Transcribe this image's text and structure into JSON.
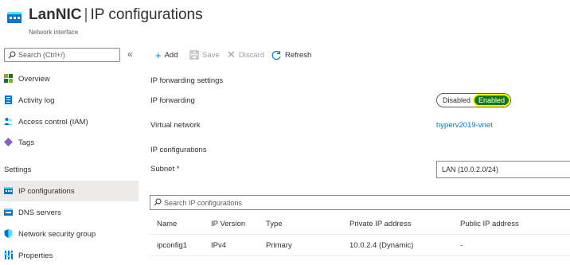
{
  "header": {
    "resource_name": "LanNIC",
    "separator": "|",
    "page_name": "IP configurations",
    "more": "···",
    "subtitle": "Network interface"
  },
  "sidebar": {
    "search_placeholder": "Search (Ctrl+/)",
    "collapse_glyph": "«",
    "items": [
      {
        "label": "Overview",
        "icon": "overview-icon"
      },
      {
        "label": "Activity log",
        "icon": "activity-log-icon"
      },
      {
        "label": "Access control (IAM)",
        "icon": "people-icon"
      },
      {
        "label": "Tags",
        "icon": "tag-icon"
      }
    ],
    "settings_header": "Settings",
    "settings_items": [
      {
        "label": "IP configurations",
        "icon": "nic-icon",
        "selected": true
      },
      {
        "label": "DNS servers",
        "icon": "dns-icon"
      },
      {
        "label": "Network security group",
        "icon": "shield-icon"
      },
      {
        "label": "Properties",
        "icon": "properties-icon"
      }
    ]
  },
  "toolbar": {
    "add": "Add",
    "save": "Save",
    "discard": "Discard",
    "refresh": "Refresh"
  },
  "main": {
    "ip_forwarding_settings": "IP forwarding settings",
    "ip_forwarding_label": "IP forwarding",
    "toggle": {
      "off": "Disabled",
      "on": "Enabled",
      "selected": "Enabled"
    },
    "virtual_network_label": "Virtual network",
    "virtual_network_value": "hyperv2019-vnet",
    "ip_configurations_heading": "IP configurations",
    "subnet_label": "Subnet *",
    "subnet_value": "LAN (10.0.2.0/24)",
    "search_placeholder": "Search IP configurations",
    "table": {
      "columns": [
        "Name",
        "IP Version",
        "Type",
        "Private IP address",
        "Public IP address"
      ],
      "rows": [
        [
          "ipconfig1",
          "IPv4",
          "Primary",
          "10.0.2.4 (Dynamic)",
          "-"
        ]
      ]
    }
  },
  "colors": {
    "accent": "#0078d4",
    "enabled_green": "#0f7b0f",
    "highlight": "#ffff00"
  }
}
